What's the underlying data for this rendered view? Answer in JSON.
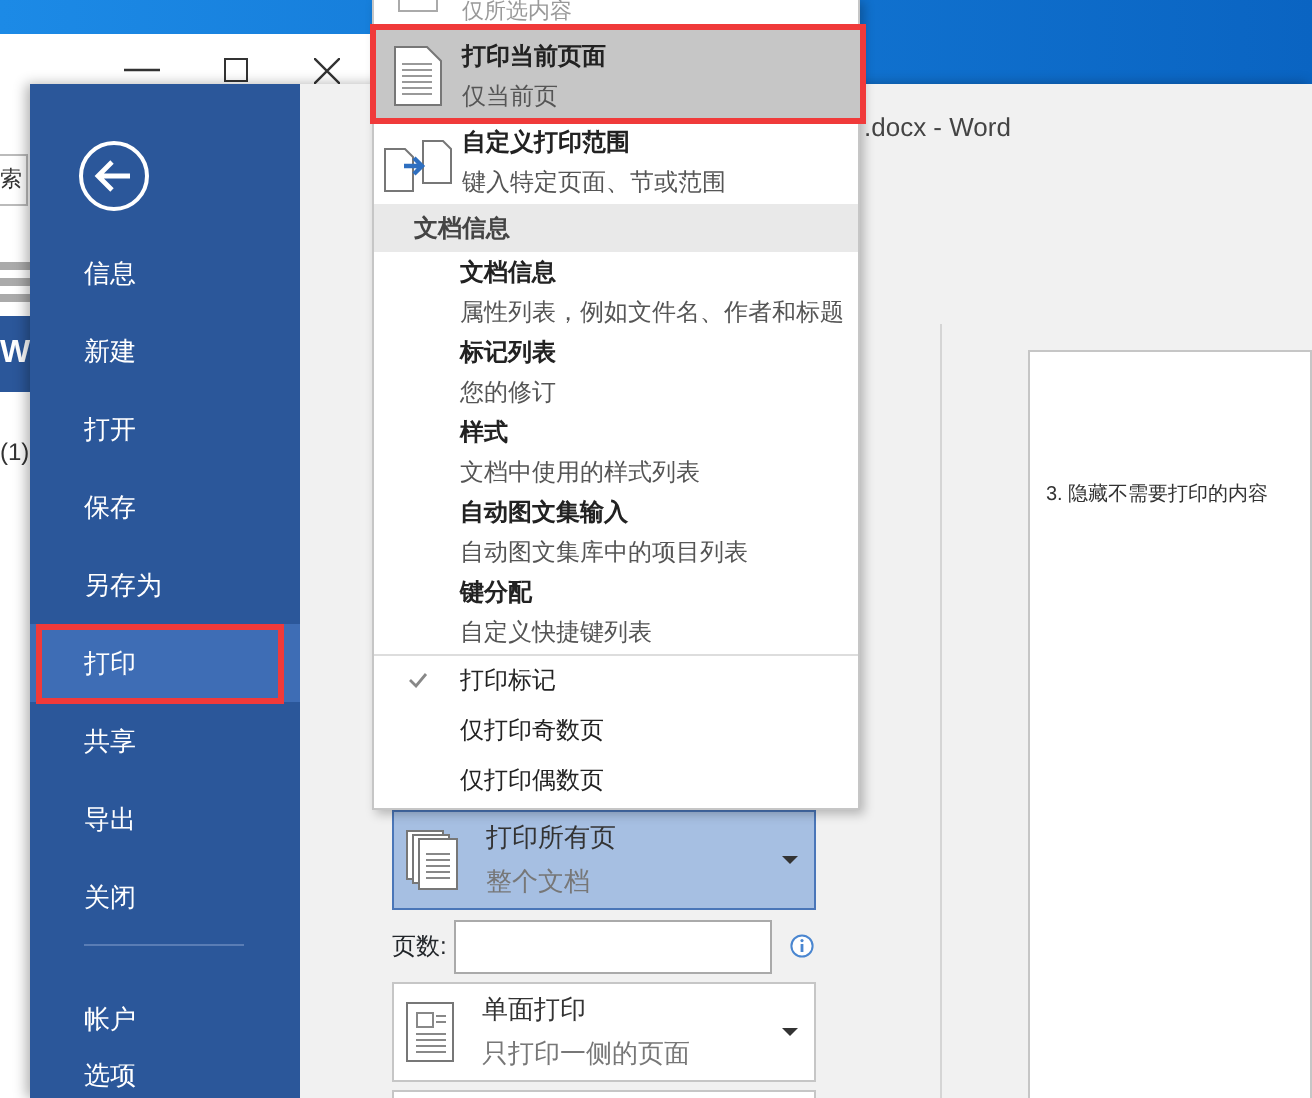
{
  "background_window": {
    "search_text": "索",
    "app_letter": "W",
    "file_label": "(1)"
  },
  "word": {
    "title": ".docx - Word",
    "sidebar": {
      "items": [
        {
          "label": "信息",
          "selected": false,
          "highlighted": false
        },
        {
          "label": "新建",
          "selected": false,
          "highlighted": false
        },
        {
          "label": "打开",
          "selected": false,
          "highlighted": false
        },
        {
          "label": "保存",
          "selected": false,
          "highlighted": false
        },
        {
          "label": "另存为",
          "selected": false,
          "highlighted": false
        },
        {
          "label": "打印",
          "selected": true,
          "highlighted": true
        },
        {
          "label": "共享",
          "selected": false,
          "highlighted": false
        },
        {
          "label": "导出",
          "selected": false,
          "highlighted": false
        },
        {
          "label": "关闭",
          "selected": false,
          "highlighted": false
        }
      ],
      "bottom_items": [
        {
          "label": "帐户",
          "selected": false
        },
        {
          "label": "选项",
          "selected": false
        }
      ]
    },
    "print_settings": {
      "pages_dropdown": {
        "title": "打印所有页",
        "subtitle": "整个文档",
        "expanded": true
      },
      "pages_label": "页数:",
      "sides_dropdown": {
        "title": "单面打印",
        "subtitle": "只打印一侧的页面",
        "expanded": false
      }
    },
    "preview": {
      "page_text": "3. 隐藏不需要打印的内容"
    }
  },
  "menu": {
    "items": [
      {
        "kind": "option",
        "subtitle": "仅所选内容",
        "selected": false,
        "highlighted": false
      },
      {
        "kind": "option",
        "title": "打印当前页面",
        "subtitle": "仅当前页",
        "selected": true,
        "highlighted": true
      },
      {
        "kind": "option",
        "title": "自定义打印范围",
        "subtitle": "键入特定页面、节或范围",
        "selected": false,
        "highlighted": false
      },
      {
        "kind": "header",
        "title": "文档信息"
      },
      {
        "kind": "info",
        "title": "文档信息",
        "subtitle": "属性列表，例如文件名、作者和标题"
      },
      {
        "kind": "info",
        "title": "标记列表",
        "subtitle": "您的修订"
      },
      {
        "kind": "info",
        "title": "样式",
        "subtitle": "文档中使用的样式列表"
      },
      {
        "kind": "info",
        "title": "自动图文集输入",
        "subtitle": "自动图文集库中的项目列表"
      },
      {
        "kind": "info",
        "title": "键分配",
        "subtitle": "自定义快捷键列表"
      },
      {
        "kind": "toggle",
        "title": "打印标记",
        "checked": true
      },
      {
        "kind": "toggle",
        "title": "仅打印奇数页",
        "checked": false
      },
      {
        "kind": "toggle",
        "title": "仅打印偶数页",
        "checked": false
      }
    ]
  }
}
